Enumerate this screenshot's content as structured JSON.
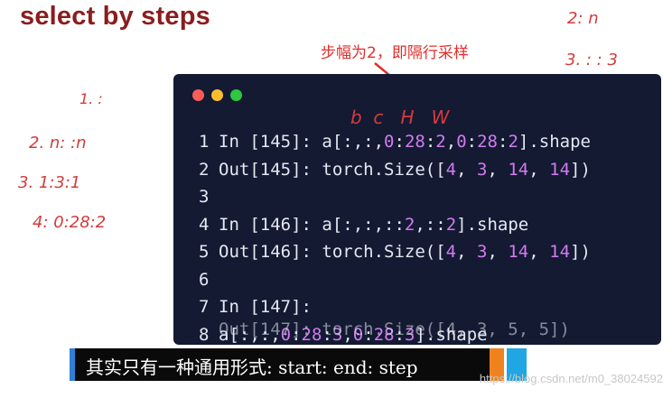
{
  "slide": {
    "title": "select by steps"
  },
  "annotation": {
    "text": "步幅为2，即隔行采样"
  },
  "editor": {
    "lines": [
      {
        "n": "1",
        "code": "In [145]: a[:,:,0:28:2,0:28:2].shape"
      },
      {
        "n": "2",
        "code": "Out[145]: torch.Size([4, 3, 14, 14])"
      },
      {
        "n": "3",
        "code": ""
      },
      {
        "n": "4",
        "code": "In [146]: a[:,:,::2,::2].shape"
      },
      {
        "n": "5",
        "code": "Out[146]: torch.Size([4, 3, 14, 14])"
      },
      {
        "n": "6",
        "code": ""
      },
      {
        "n": "7",
        "code": "In [147]:"
      },
      {
        "n": "8",
        "code": "a[:,:,0:28:3,0:28:3].shape"
      }
    ],
    "overlap_text": "Out[147]: torch.Size([4, 3, 5, 5])"
  },
  "subtitle": {
    "text": "其实只有一种通用形式: start: end: step"
  },
  "watermark": {
    "text": "https://blog.csdn.net/m0_38024592"
  },
  "handwriting": {
    "left_1": "1. :",
    "left_2": "2. n: :n",
    "left_3": "3. 1:3:1",
    "left_4": "4: 0:28:2",
    "top_right_1": "2: n",
    "top_right_2": "3. : : 3",
    "bcw": "b  c   H   W"
  },
  "colors": {
    "editor_bg": "#131a32",
    "number": "#d27bef",
    "title": "#8b1d1d",
    "annotation": "#e0302c"
  }
}
